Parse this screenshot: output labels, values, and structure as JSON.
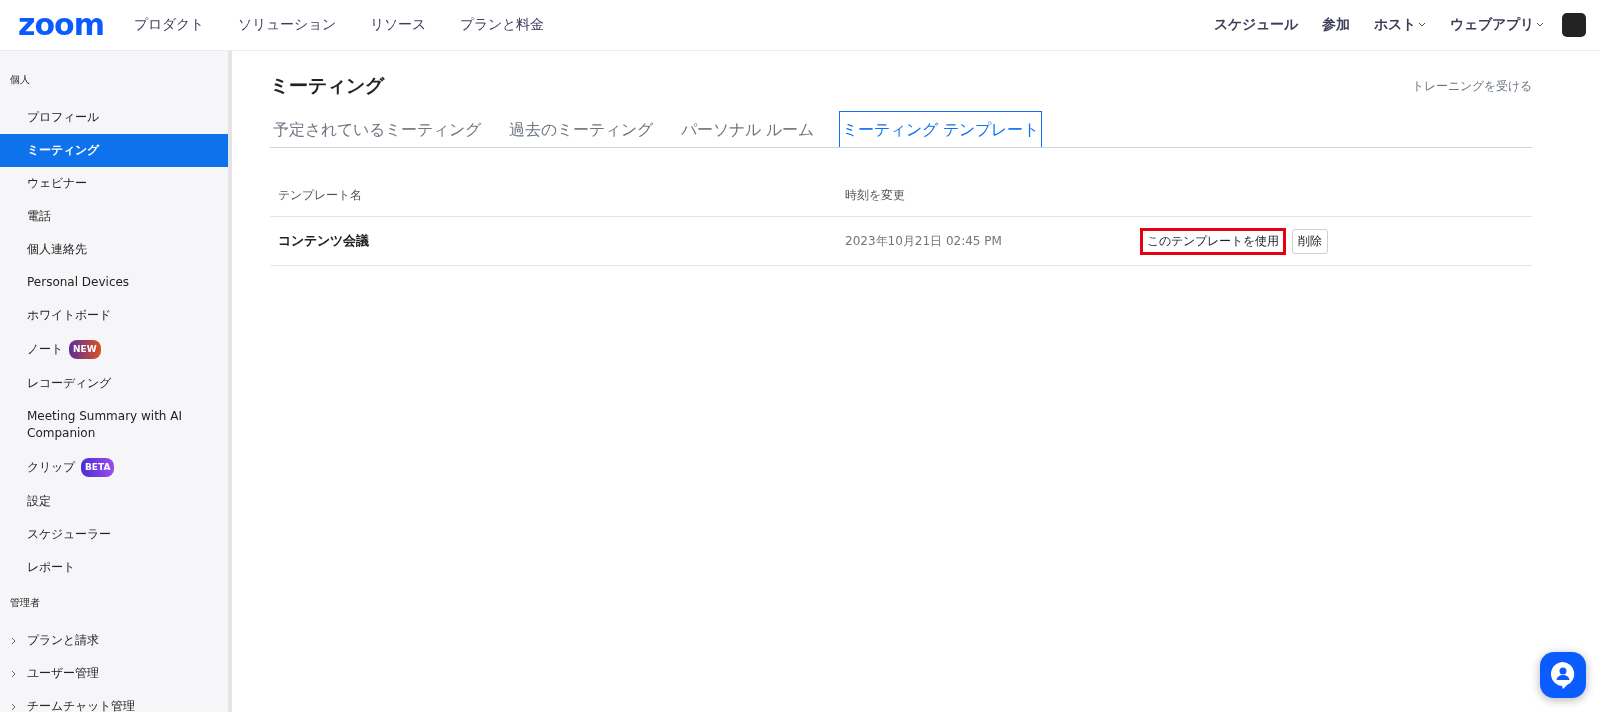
{
  "header": {
    "logo": "zoom",
    "nav": [
      "プロダクト",
      "ソリューション",
      "リソース",
      "プランと料金"
    ],
    "actions": [
      {
        "label": "スケジュール",
        "dropdown": false
      },
      {
        "label": "参加",
        "dropdown": false
      },
      {
        "label": "ホスト",
        "dropdown": true
      },
      {
        "label": "ウェブアプリ",
        "dropdown": true
      }
    ]
  },
  "sidebar": {
    "sections": [
      {
        "title": "個人",
        "items": [
          {
            "label": "プロフィール",
            "selected": false,
            "expandable": false
          },
          {
            "label": "ミーティング",
            "selected": true,
            "expandable": false
          },
          {
            "label": "ウェビナー",
            "selected": false,
            "expandable": false
          },
          {
            "label": "電話",
            "selected": false,
            "expandable": false
          },
          {
            "label": "個人連絡先",
            "selected": false,
            "expandable": false
          },
          {
            "label": "Personal Devices",
            "selected": false,
            "expandable": false
          },
          {
            "label": "ホワイトボード",
            "selected": false,
            "expandable": false
          },
          {
            "label": "ノート",
            "selected": false,
            "expandable": false,
            "badge": {
              "kind": "new",
              "text": "NEW"
            }
          },
          {
            "label": "レコーディング",
            "selected": false,
            "expandable": false
          },
          {
            "label": "Meeting Summary with AI Companion",
            "selected": false,
            "expandable": false
          },
          {
            "label": "クリップ",
            "selected": false,
            "expandable": false,
            "badge": {
              "kind": "beta",
              "text": "BETA"
            }
          },
          {
            "label": "設定",
            "selected": false,
            "expandable": false
          },
          {
            "label": "スケジューラー",
            "selected": false,
            "expandable": false
          },
          {
            "label": "レポート",
            "selected": false,
            "expandable": false
          }
        ]
      },
      {
        "title": "管理者",
        "items": [
          {
            "label": "プランと請求",
            "selected": false,
            "expandable": true
          },
          {
            "label": "ユーザー管理",
            "selected": false,
            "expandable": true
          },
          {
            "label": "チームチャット管理",
            "selected": false,
            "expandable": true
          }
        ]
      }
    ]
  },
  "page": {
    "title": "ミーティング",
    "training_link": "トレーニングを受ける",
    "tabs": [
      {
        "label": "予定されているミーティング",
        "selected": false
      },
      {
        "label": "過去のミーティング",
        "selected": false
      },
      {
        "label": "パーソナル ルーム",
        "selected": false
      },
      {
        "label": "ミーティング テンプレート",
        "selected": true
      }
    ],
    "table": {
      "columns": [
        "テンプレート名",
        "時刻を変更"
      ],
      "rows": [
        {
          "name": "コンテンツ会議",
          "modified": "2023年10月21日 02:45 PM",
          "actions": [
            {
              "label": "このテンプレートを使用",
              "highlighted": true
            },
            {
              "label": "削除",
              "highlighted": false
            }
          ]
        }
      ]
    }
  }
}
